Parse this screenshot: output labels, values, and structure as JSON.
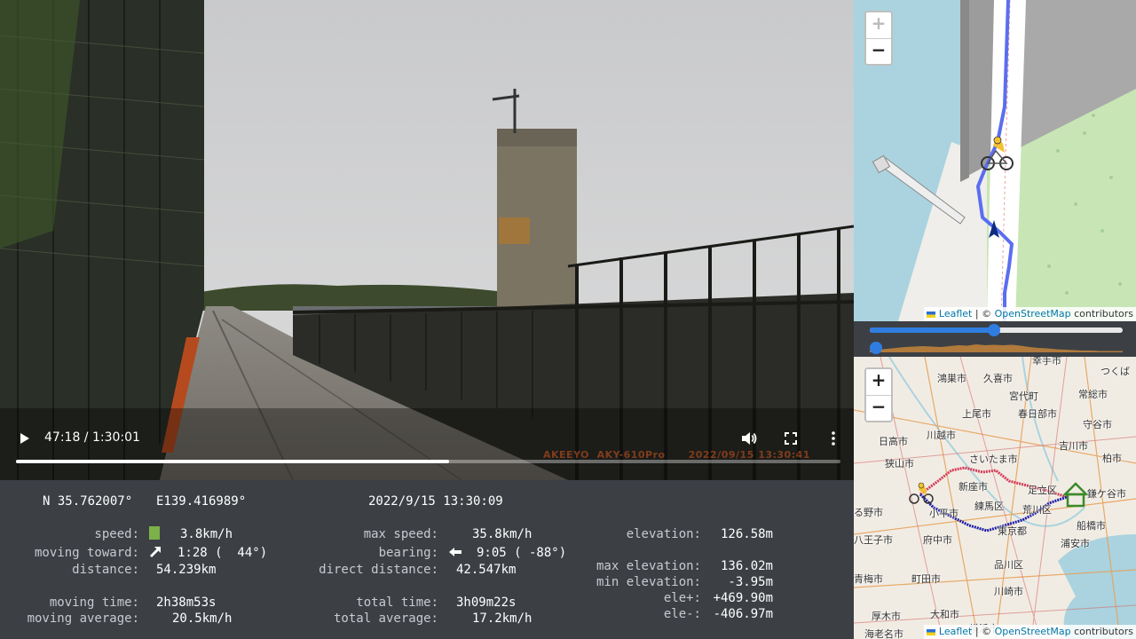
{
  "video": {
    "current_time": "47:18",
    "duration": "1:30:01",
    "time_display": "47:18 / 1:30:01",
    "progress_fraction": 0.525,
    "overlay_brand": "AKEEYO  AKY-610Pro",
    "overlay_timestamp": "2022/09/15 13:30:41",
    "icons": {
      "play": "play-icon",
      "volume": "volume-icon",
      "fullscreen": "fullscreen-icon",
      "more": "more-vertical-icon"
    }
  },
  "stats": {
    "latitude": "N 35.762007°",
    "longitude": "E139.416989°",
    "datetime": "2022/9/15 13:30:09",
    "speed_label": "speed:",
    "speed_value": "3.8km/h",
    "speed_indicator_color": "#7cb14a",
    "moving_toward_label": "moving toward:",
    "moving_toward_value": "1:28 (  44°)",
    "distance_label": "distance:",
    "distance_value": "54.239km",
    "moving_time_label": "moving time:",
    "moving_time_value": "2h38m53s",
    "moving_average_label": "moving average:",
    "moving_average_value": "20.5km/h",
    "max_speed_label": "max speed:",
    "max_speed_value": "35.8km/h",
    "bearing_label": "bearing:",
    "bearing_value": "9:05 ( -88°)",
    "direct_distance_label": "direct distance:",
    "direct_distance_value": "42.547km",
    "total_time_label": "total time:",
    "total_time_value": "3h09m22s",
    "total_average_label": "total average:",
    "total_average_value": "17.2km/h",
    "elevation_label": "elevation:",
    "elevation_value": "126.58m",
    "max_elevation_label": "max elevation:",
    "max_elevation_value": "136.02m",
    "min_elevation_label": "min elevation:",
    "min_elevation_value": "-3.95m",
    "ele_plus_label": "ele+:",
    "ele_plus_value": "+469.90m",
    "ele_minus_label": "ele-:",
    "ele_minus_value": "-406.97m"
  },
  "detail_map": {
    "zoom_in": "+",
    "zoom_out": "−",
    "attribution_link": "Leaflet",
    "attribution_separator": " | © ",
    "attribution_osm": "OpenStreetMap",
    "attribution_suffix": " contributors",
    "route_color": "#5b6ef0",
    "water_color": "#aad3df",
    "park_color": "#c8e6b5"
  },
  "timeline": {
    "range_position": 0.49,
    "elevation_thumb_position": 0.0,
    "elevation_color": "#b07a3c",
    "accent_color": "#2f7de1"
  },
  "overview_map": {
    "zoom_in": "+",
    "zoom_out": "−",
    "attribution_link": "Leaflet",
    "attribution_separator": " | © ",
    "attribution_osm": "OpenStreetMap",
    "attribution_suffix": " contributors",
    "route_outbound_color": "#d43a5a",
    "route_return_color": "#1c1ca8",
    "cities": [
      "鴻巣市",
      "久喜市",
      "幸手市",
      "つくば",
      "宮代町",
      "常総市",
      "上尾市",
      "春日部市",
      "守谷市",
      "日高市",
      "川越市",
      "吉川市",
      "狭山市",
      "さいたま市",
      "柏市",
      "新座市",
      "足立区",
      "鎌ケ谷市",
      "練馬区",
      "荒川区",
      "る野市",
      "小平市",
      "船橋市",
      "東京都",
      "八王子市",
      "府中市",
      "浦安市",
      "品川区",
      "青梅市",
      "町田市",
      "川崎市",
      "厚木市",
      "大和市",
      "海老名市",
      "横浜市"
    ]
  }
}
